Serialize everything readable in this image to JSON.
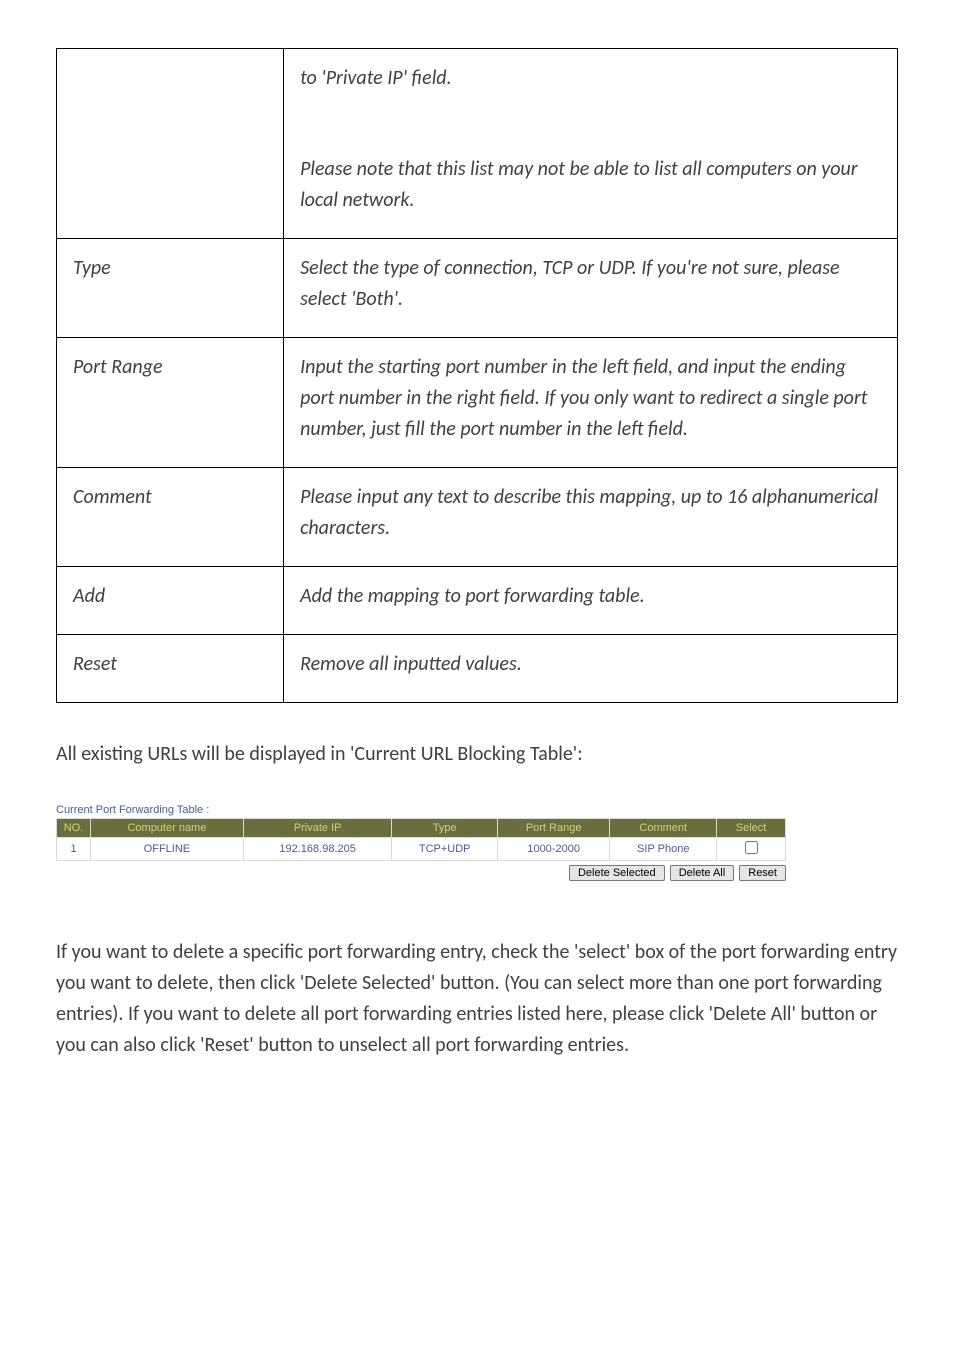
{
  "definitions": [
    {
      "term": "",
      "desc_lines": [
        "to 'Private IP' field.",
        "",
        "Please note that this list may not be able to list all computers on your local network."
      ]
    },
    {
      "term": "Type",
      "desc": "Select the type of connection, TCP or UDP. If you're not sure, please select 'Both'."
    },
    {
      "term": "Port Range",
      "desc": "Input the starting port number in the left field, and input the ending port number in the right field. If you only want to redirect a single port number, just fill the port number in the left field."
    },
    {
      "term": "Comment",
      "desc": "Please input any text to describe this mapping, up to 16 alphanumerical characters."
    },
    {
      "term": "Add",
      "desc": "Add the mapping to port forwarding table."
    },
    {
      "term": "Reset",
      "desc": "Remove all inputted values."
    }
  ],
  "after_table_text": "All existing URLs will be displayed in 'Current URL Blocking Table':",
  "pf_widget": {
    "caption": "Current Port Forwarding Table :",
    "headers": [
      "NO.",
      "Computer name",
      "Private IP",
      "Type",
      "Port Range",
      "Comment",
      "Select"
    ],
    "row": {
      "no": "1",
      "computer_name": "OFFLINE",
      "private_ip": "192.168.98.205",
      "type": "TCP+UDP",
      "port_range": "1000-2000",
      "comment": "SIP Phone"
    },
    "buttons": {
      "delete_selected": "Delete Selected",
      "delete_all": "Delete All",
      "reset": "Reset"
    }
  },
  "bottom_text": "If you want to delete a specific port forwarding entry, check the 'select' box of the port forwarding entry you want to delete, then click 'Delete Selected' button. (You can select more than one port forwarding entries). If you want to delete all port forwarding entries listed here, please click 'Delete All' button or you can also click 'Reset' button to unselect all port forwarding entries."
}
